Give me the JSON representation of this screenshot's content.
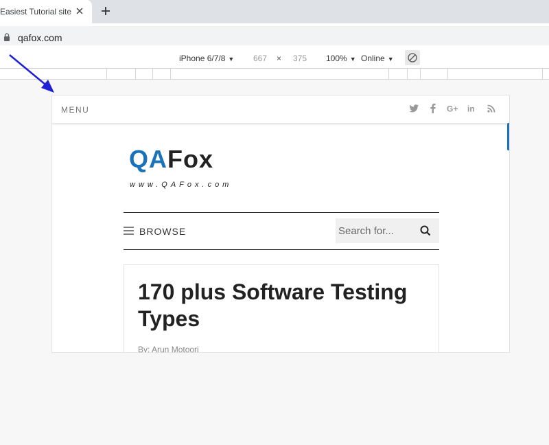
{
  "browser": {
    "tab_title": "Easiest Tutorial site",
    "url": "qafox.com"
  },
  "device_toolbar": {
    "device": "iPhone 6/7/8",
    "width": "667",
    "times": "×",
    "height": "375",
    "zoom": "100%",
    "network": "Online"
  },
  "site": {
    "menu_label": "MENU",
    "social_icons": [
      "twitter-icon",
      "facebook-icon",
      "google-plus-icon",
      "linkedin-icon",
      "rss-icon"
    ],
    "logo_qa": "QA",
    "logo_fox": "Fox",
    "tagline": "www.QAFox.com",
    "browse_label": "BROWSE",
    "search_placeholder": "Search for...",
    "article_title": "170 plus Software Testing Types",
    "byline": "By: Arun Motoori"
  },
  "colors": {
    "brand_blue": "#1a73b8",
    "annotation_arrow": "#1f1fd6"
  }
}
